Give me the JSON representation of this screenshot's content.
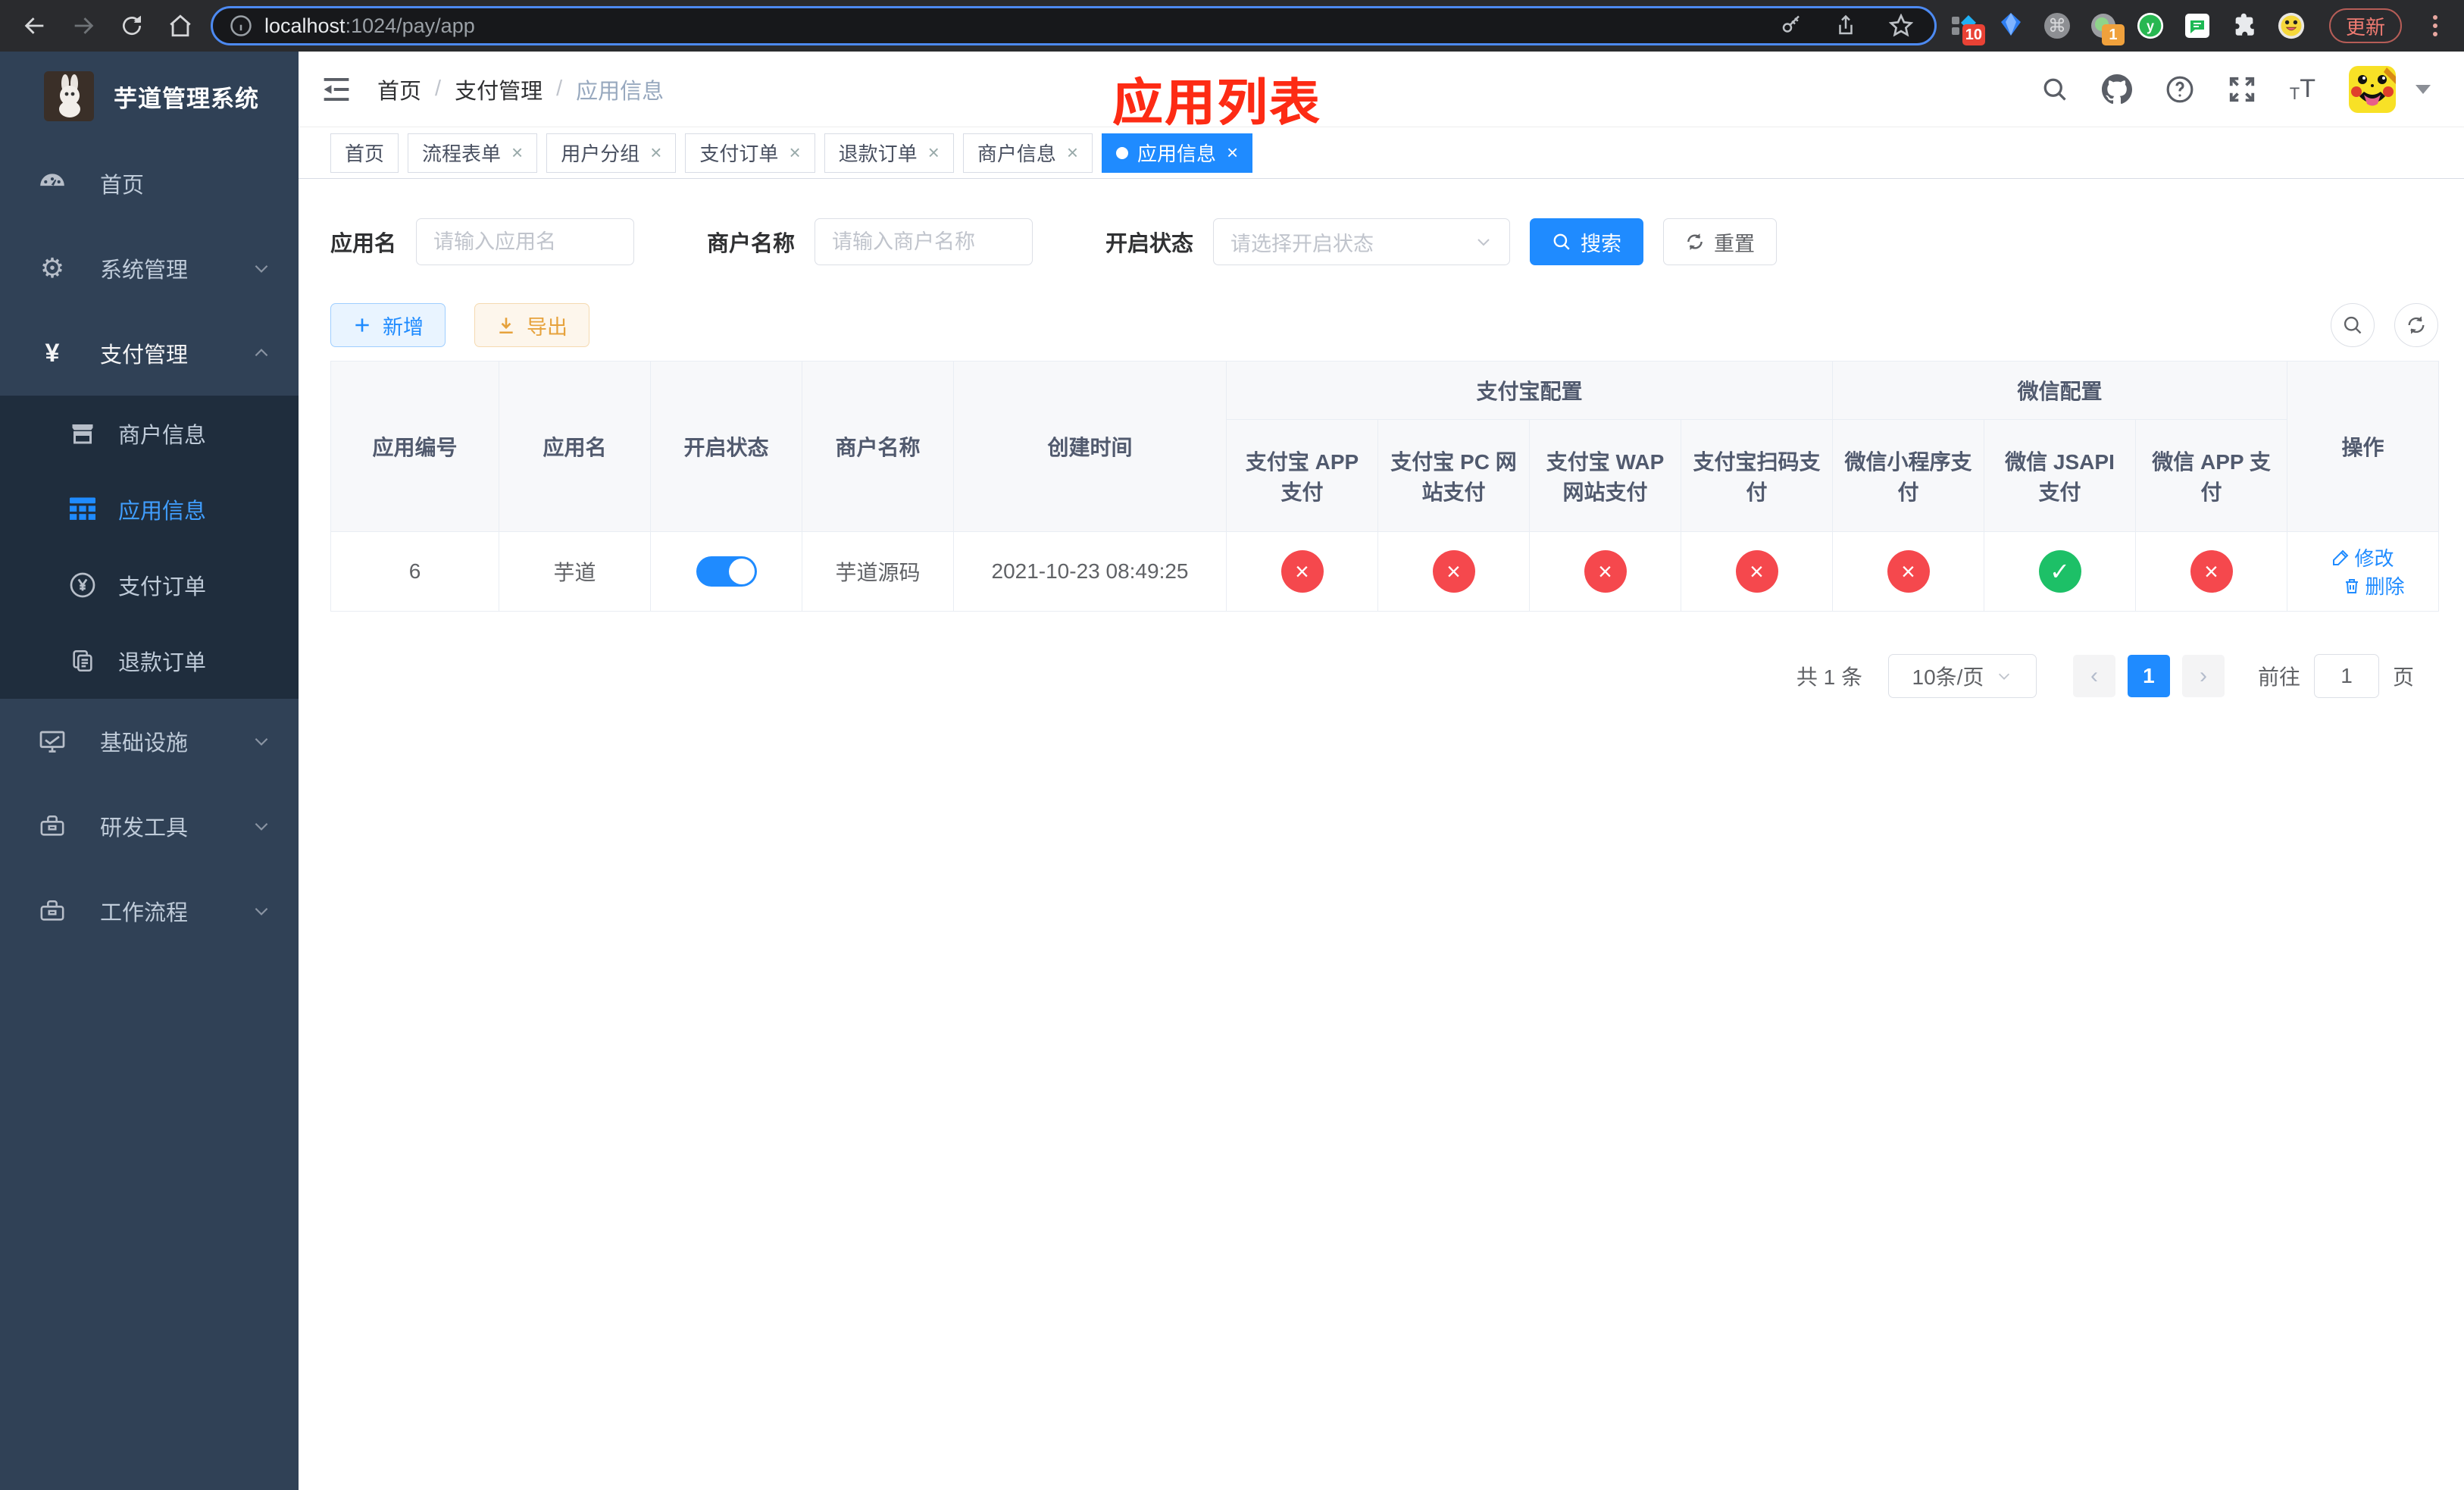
{
  "browser": {
    "url": {
      "host": "localhost",
      "rest": ":1024/pay/app"
    },
    "update_label": "更新",
    "ext_badge_1": "10",
    "ext_badge_2": "1"
  },
  "sidebar": {
    "title": "芋道管理系统",
    "menu": [
      {
        "label": "首页"
      },
      {
        "label": "系统管理"
      },
      {
        "label": "支付管理"
      },
      {
        "label": "商户信息"
      },
      {
        "label": "应用信息"
      },
      {
        "label": "支付订单"
      },
      {
        "label": "退款订单"
      },
      {
        "label": "基础设施"
      },
      {
        "label": "研发工具"
      },
      {
        "label": "工作流程"
      }
    ]
  },
  "navbar": {
    "breadcrumb": [
      "首页",
      "支付管理",
      "应用信息"
    ]
  },
  "annotation_title": "应用列表",
  "tabs": [
    {
      "label": "首页",
      "closable": false,
      "active": false
    },
    {
      "label": "流程表单",
      "closable": true,
      "active": false
    },
    {
      "label": "用户分组",
      "closable": true,
      "active": false
    },
    {
      "label": "支付订单",
      "closable": true,
      "active": false
    },
    {
      "label": "退款订单",
      "closable": true,
      "active": false
    },
    {
      "label": "商户信息",
      "closable": true,
      "active": false
    },
    {
      "label": "应用信息",
      "closable": true,
      "active": true
    }
  ],
  "filters": {
    "app_name": {
      "label": "应用名",
      "placeholder": "请输入应用名"
    },
    "merchant": {
      "label": "商户名称",
      "placeholder": "请输入商户名称"
    },
    "status": {
      "label": "开启状态",
      "placeholder": "请选择开启状态"
    },
    "search_label": "搜索",
    "reset_label": "重置"
  },
  "toolbar": {
    "add_label": "新增",
    "export_label": "导出"
  },
  "table": {
    "groups": {
      "alipay": "支付宝配置",
      "wechat": "微信配置"
    },
    "columns": {
      "id": "应用编号",
      "name": "应用名",
      "enabled": "开启状态",
      "merchant": "商户名称",
      "created": "创建时间",
      "actions": "操作",
      "subs": [
        "支付宝 APP 支付",
        "支付宝 PC 网站支付",
        "支付宝 WAP 网站支付",
        "支付宝扫码支付",
        "微信小程序支付",
        "微信 JSAPI 支付",
        "微信 APP 支付"
      ]
    },
    "row": {
      "id": "6",
      "name": "芋道",
      "enabled": true,
      "merchant": "芋道源码",
      "created": "2021-10-23 08:49:25",
      "statuses": [
        "fail",
        "fail",
        "fail",
        "fail",
        "fail",
        "ok",
        "fail"
      ],
      "edit_label": "修改",
      "delete_label": "删除"
    }
  },
  "pagination": {
    "total": "共 1 条",
    "page_size": "10条/页",
    "page": "1",
    "goto_label": "前往",
    "goto_value": "1",
    "unit": "页"
  },
  "glyphs": {
    "fail": "×",
    "ok": "✓",
    "close": "×",
    "breadcrumb_sep": "/",
    "prev": "‹",
    "next": "›",
    "cmd": "⌘"
  },
  "colors": {
    "primary": "#1f8bff",
    "success": "#1dc067",
    "danger": "#f5484d",
    "warning": "#e6a23c",
    "sidebar_bg": "#304156",
    "submenu_bg": "#1f2d3d",
    "annotation": "#fd2b14"
  }
}
